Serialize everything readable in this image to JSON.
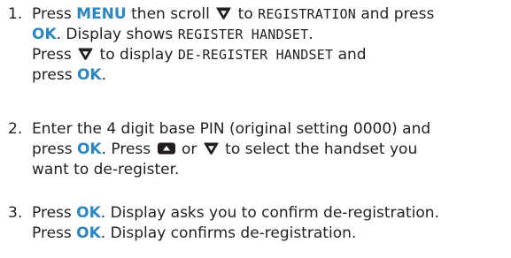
{
  "colors": {
    "keyword": "#2e86c1",
    "text": "#231f20",
    "icon": "#231f20"
  },
  "steps": [
    {
      "number": "1.",
      "lines": [
        {
          "t1": "Press ",
          "k1": "MENU",
          "t2": " then scroll ",
          "icon1": "down-arrow-icon",
          "t3": " to ",
          "d1": "REGISTRATION",
          "t4": " and press"
        },
        {
          "k1": "OK",
          "t1": ". Display shows ",
          "d1": "REGISTER HANDSET",
          "t2": "."
        },
        {
          "t1": "Press ",
          "icon1": "down-arrow-icon",
          "t2": " to display ",
          "d1": "DE-REGISTER HANDSET",
          "t3": " and"
        },
        {
          "t1": "press ",
          "k1": "OK",
          "t2": "."
        }
      ]
    },
    {
      "number": "2.",
      "lines": [
        {
          "t1": "Enter the 4 digit base PIN (original setting 0000) and"
        },
        {
          "t1": "press ",
          "k1": "OK",
          "t2": ". Press ",
          "icon1": "up-arrow-icon",
          "t3": " or ",
          "icon2": "down-arrow-icon",
          "t4": " to select the handset you"
        },
        {
          "t1": "want to de-register."
        }
      ]
    },
    {
      "number": "3.",
      "lines": [
        {
          "t1": "Press ",
          "k1": "OK",
          "t2": ". Display asks you to confirm de-registration."
        },
        {
          "t1": "Press ",
          "k1": "OK",
          "t2": ". Display confirms de-registration."
        }
      ]
    }
  ]
}
